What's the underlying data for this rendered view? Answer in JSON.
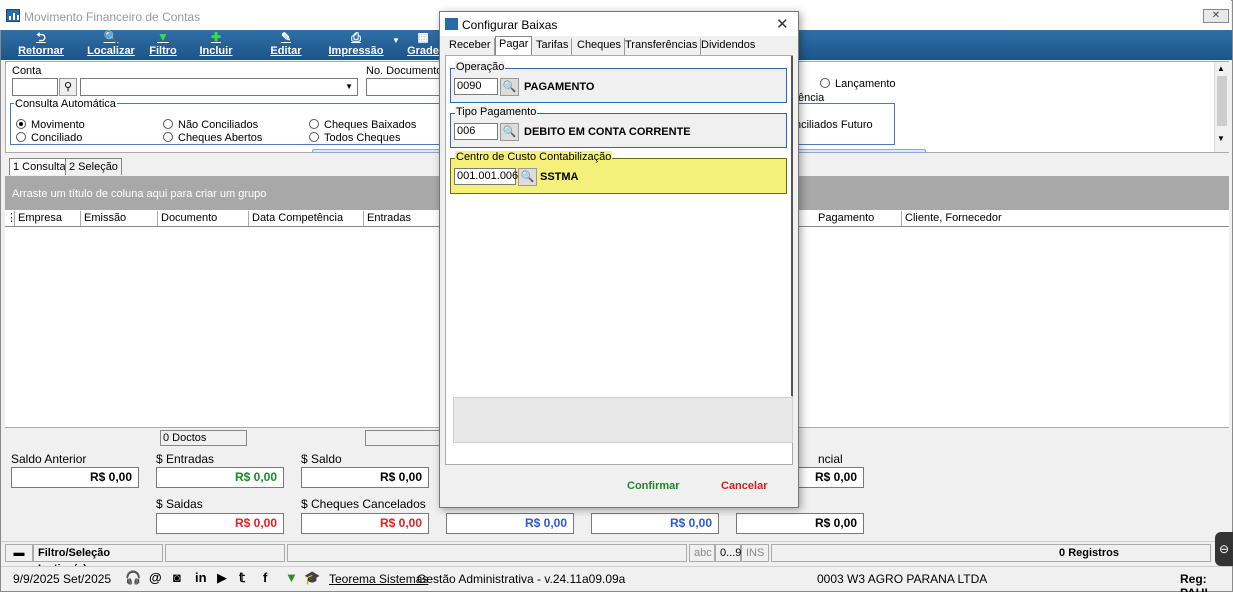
{
  "window": {
    "title": "Movimento Financeiro de Contas"
  },
  "toolbar": [
    {
      "label": "Retornar",
      "icon": "undo-icon",
      "glyph": "⮌"
    },
    {
      "label": "Localizar",
      "icon": "search-icon",
      "glyph": "🔍"
    },
    {
      "label": "Filtro",
      "icon": "filter-icon",
      "glyph": "▼"
    },
    {
      "label": "Incluir",
      "icon": "add-icon",
      "glyph": "✚"
    },
    {
      "label": "Editar",
      "icon": "edit-icon",
      "glyph": "✎"
    },
    {
      "label": "Impressão",
      "icon": "print-icon",
      "glyph": "⎙"
    },
    {
      "label": "Grade",
      "icon": "grid-icon",
      "glyph": "▦"
    }
  ],
  "panel": {
    "conta_label": "Conta",
    "nodoc_label": "No. Documento",
    "consulta_label": "Consulta Automática",
    "radios": [
      {
        "label": "Movimento",
        "checked": true
      },
      {
        "label": "Conciliado",
        "checked": false
      },
      {
        "label": "Não Conciliados",
        "checked": false
      },
      {
        "label": "Cheques Abertos",
        "checked": false
      },
      {
        "label": "Cheques Baixados",
        "checked": false
      },
      {
        "label": "Todos Cheques",
        "checked": false
      }
    ],
    "right_radio": "Lançamento",
    "right_text1": "ência",
    "right_text2": "nciliados Futuro"
  },
  "tabs": [
    {
      "label": "1 Consulta"
    },
    {
      "label": "2 Seleção"
    }
  ],
  "group_hint": "Arraste um título de coluna aqui para criar um grupo",
  "columns": [
    "Empresa",
    "Emissão",
    "Documento",
    "Data Competência",
    "Entradas",
    "Pagamento",
    "Cliente, Fornecedor"
  ],
  "footer": {
    "doctos": "0 Doctos"
  },
  "totals": {
    "saldo_anterior": {
      "label": "Saldo Anterior",
      "value": "R$ 0,00"
    },
    "entradas": {
      "label": "$ Entradas",
      "value": "R$ 0,00"
    },
    "saldo": {
      "label": "$ Saldo",
      "value": "R$ 0,00"
    },
    "saidas": {
      "label": "$ Saidas",
      "value": "R$ 0,00"
    },
    "cheques_cancelados": {
      "label": "$ Cheques Cancelados",
      "value": "R$ 0,00"
    },
    "nao_conciliados": {
      "value": "R$ 0,00"
    },
    "cheques_recebidos": {
      "value": "R$ 0,00"
    },
    "saldo_geral": {
      "value": "R$ 0,00"
    },
    "pendencial": {
      "label": "ncial",
      "value": "R$ 0,00"
    }
  },
  "statusbar": {
    "filtro": "Filtro/Seleção Inativo(s)",
    "abc": "abc",
    "num": "0...9",
    "ins": "INS",
    "registros": "0 Registros"
  },
  "bottombar": {
    "date": "9/9/2025 Set/2025",
    "company": "Teorema Sistemas",
    "version": "Gestão Administrativa - v.24.11a09.09a",
    "empresa": "0003 W3 AGRO PARANA LTDA",
    "reg": "Reg: PAUL"
  },
  "dialog": {
    "title": "Configurar Baixas",
    "tabs": [
      "Receber",
      "Pagar",
      "Tarifas",
      "Cheques",
      "Transferências",
      "Dividendos"
    ],
    "operacao": {
      "legend": "Operação",
      "code": "0090",
      "desc": "PAGAMENTO"
    },
    "tipo": {
      "legend": "Tipo Pagamento",
      "code": "006",
      "desc": "DEBITO EM CONTA CORRENTE"
    },
    "centro": {
      "legend": "Centro de Custo Contabilização",
      "code": "001.001.006",
      "desc": "SSTMA"
    },
    "confirm": "Confirmar",
    "cancel": "Cancelar"
  }
}
